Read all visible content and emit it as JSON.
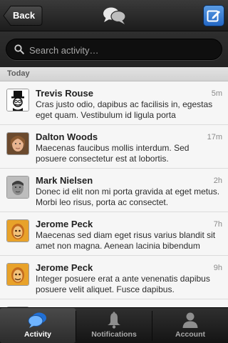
{
  "navbar": {
    "back_label": "Back",
    "logo_icon": "speech-bubbles-icon",
    "compose_icon": "compose-icon",
    "accent": "#2f78d8"
  },
  "search": {
    "placeholder": "Search activity…",
    "value": ""
  },
  "section": {
    "title": "Today"
  },
  "feed": {
    "items": [
      {
        "name": "Trevis Rouse",
        "time": "5m",
        "message": "Cras justo odio, dapibus ac facilisis in, egestas eget quam. Vestibulum id ligula porta",
        "avatar": "tophat-avatar"
      },
      {
        "name": "Dalton Woods",
        "time": "17m",
        "message": "Maecenas faucibus mollis interdum. Sed posuere consectetur est at lobortis.",
        "avatar": "photo-avatar"
      },
      {
        "name": "Mark Nielsen",
        "time": "2h",
        "message": "Donec id elit non mi porta gravida at eget metus. Morbi leo risus, porta ac consectet.",
        "avatar": "photo-avatar"
      },
      {
        "name": "Jerome Peck",
        "time": "7h",
        "message": "Maecenas sed diam eget risus varius blandit sit amet non magna. Aenean lacinia bibendum",
        "avatar": "illustrated-avatar"
      },
      {
        "name": "Jerome Peck",
        "time": "9h",
        "message": "Integer posuere erat a ante venenatis dapibus posuere velit aliquet. Fusce dapibus.",
        "avatar": "illustrated-avatar"
      }
    ]
  },
  "tabs": {
    "activity": "Activity",
    "notifications": "Notifications",
    "account": "Account",
    "selected": "Activity"
  }
}
